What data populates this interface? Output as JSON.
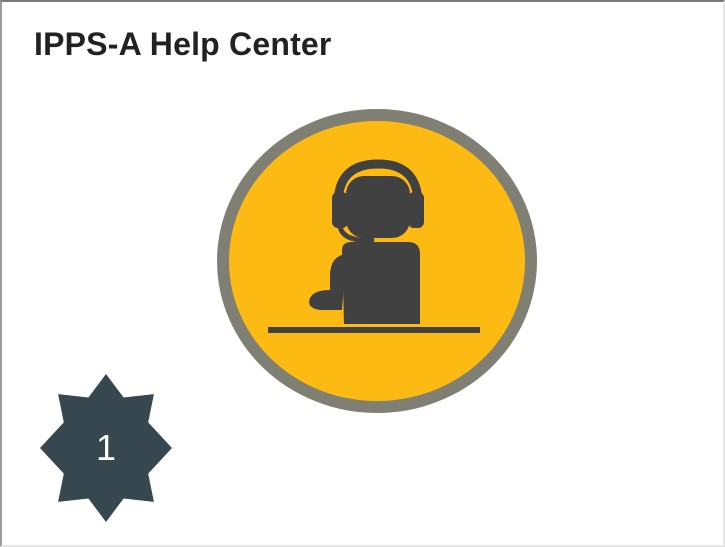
{
  "tile": {
    "title": "IPPS-A Help Center",
    "icon": "customer-support-headset-icon"
  },
  "callout": {
    "number": "1"
  },
  "colors": {
    "icon_fill": "#FDBA12",
    "icon_ring": "#7F7F74",
    "figure": "#414141",
    "callout_badge": "#37474F"
  }
}
